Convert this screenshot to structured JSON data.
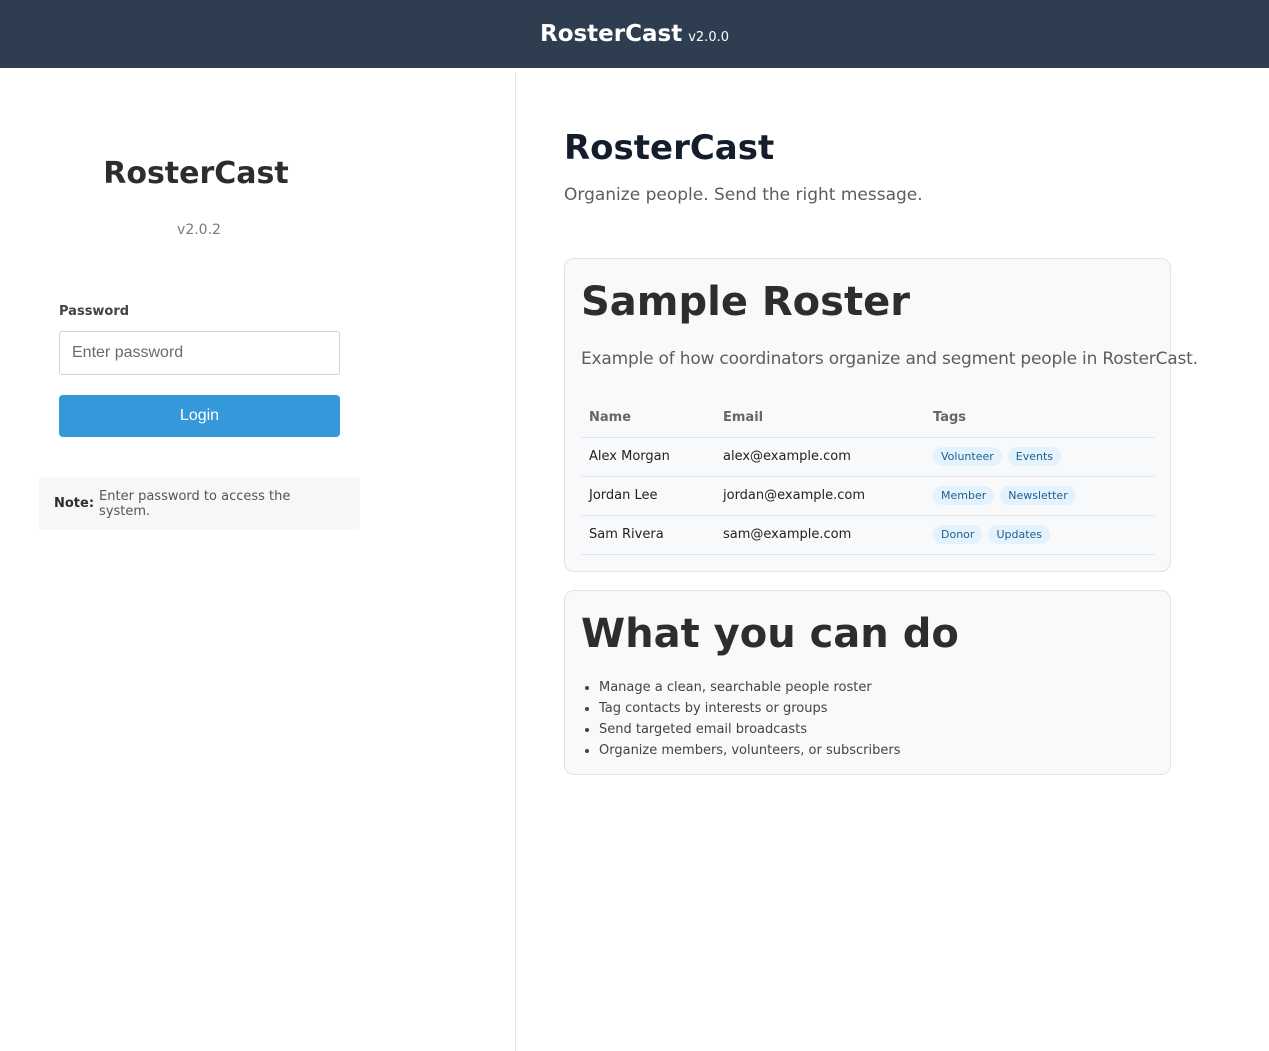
{
  "header": {
    "title": "RosterCast",
    "version": "v2.0.0"
  },
  "login": {
    "title": "RosterCast",
    "version": "v2.0.2",
    "password_label": "Password",
    "password_placeholder": "Enter password",
    "login_label": "Login",
    "note_bold": "Note:",
    "note_text": "Enter password to access the system."
  },
  "hero": {
    "title": "RosterCast",
    "subtitle": "Organize people. Send the right message."
  },
  "roster": {
    "title": "Sample Roster",
    "description": "Example of how coordinators organize and segment people in RosterCast.",
    "columns": [
      "Name",
      "Email",
      "Tags"
    ],
    "rows": [
      {
        "name": "Alex Morgan",
        "email": "alex@example.com",
        "tags": [
          "Volunteer",
          "Events"
        ]
      },
      {
        "name": "Jordan Lee",
        "email": "jordan@example.com",
        "tags": [
          "Member",
          "Newsletter"
        ]
      },
      {
        "name": "Sam Rivera",
        "email": "sam@example.com",
        "tags": [
          "Donor",
          "Updates"
        ]
      }
    ]
  },
  "features": {
    "title": "What you can do",
    "items": [
      "Manage a clean, searchable people roster",
      "Tag contacts by interests or groups",
      "Send targeted email broadcasts",
      "Organize members, volunteers, or subscribers"
    ]
  },
  "colors": {
    "header_bg": "#2e3e50",
    "primary": "#3598db",
    "tag_bg": "#e3f2fd",
    "tag_text": "#1e5f8e"
  }
}
